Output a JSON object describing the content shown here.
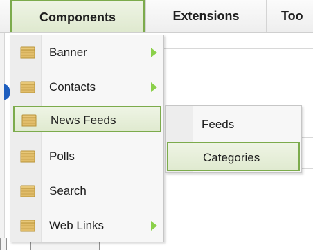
{
  "menubar": {
    "items": [
      {
        "label": "Components"
      },
      {
        "label": "Extensions"
      },
      {
        "label": "Too"
      }
    ]
  },
  "dropdown": {
    "items": [
      {
        "label": "Banner",
        "icon": "folder-icon",
        "has_submenu": true
      },
      {
        "label": "Contacts",
        "icon": "folder-icon",
        "has_submenu": true
      },
      {
        "label": "News Feeds",
        "icon": "folder-icon",
        "has_submenu": false,
        "active": true
      },
      {
        "label": "Polls",
        "icon": "folder-icon",
        "has_submenu": false
      },
      {
        "label": "Search",
        "icon": "folder-icon",
        "has_submenu": false
      },
      {
        "label": "Web Links",
        "icon": "folder-icon",
        "has_submenu": true
      }
    ]
  },
  "submenu": {
    "items": [
      {
        "label": "Feeds"
      },
      {
        "label": "Categories",
        "active": true
      }
    ]
  },
  "colors": {
    "highlight_border": "#7cab4c",
    "highlight_bg": "#e6efd9",
    "arrow": "#8bd04a",
    "folder": "#d9b65c"
  }
}
